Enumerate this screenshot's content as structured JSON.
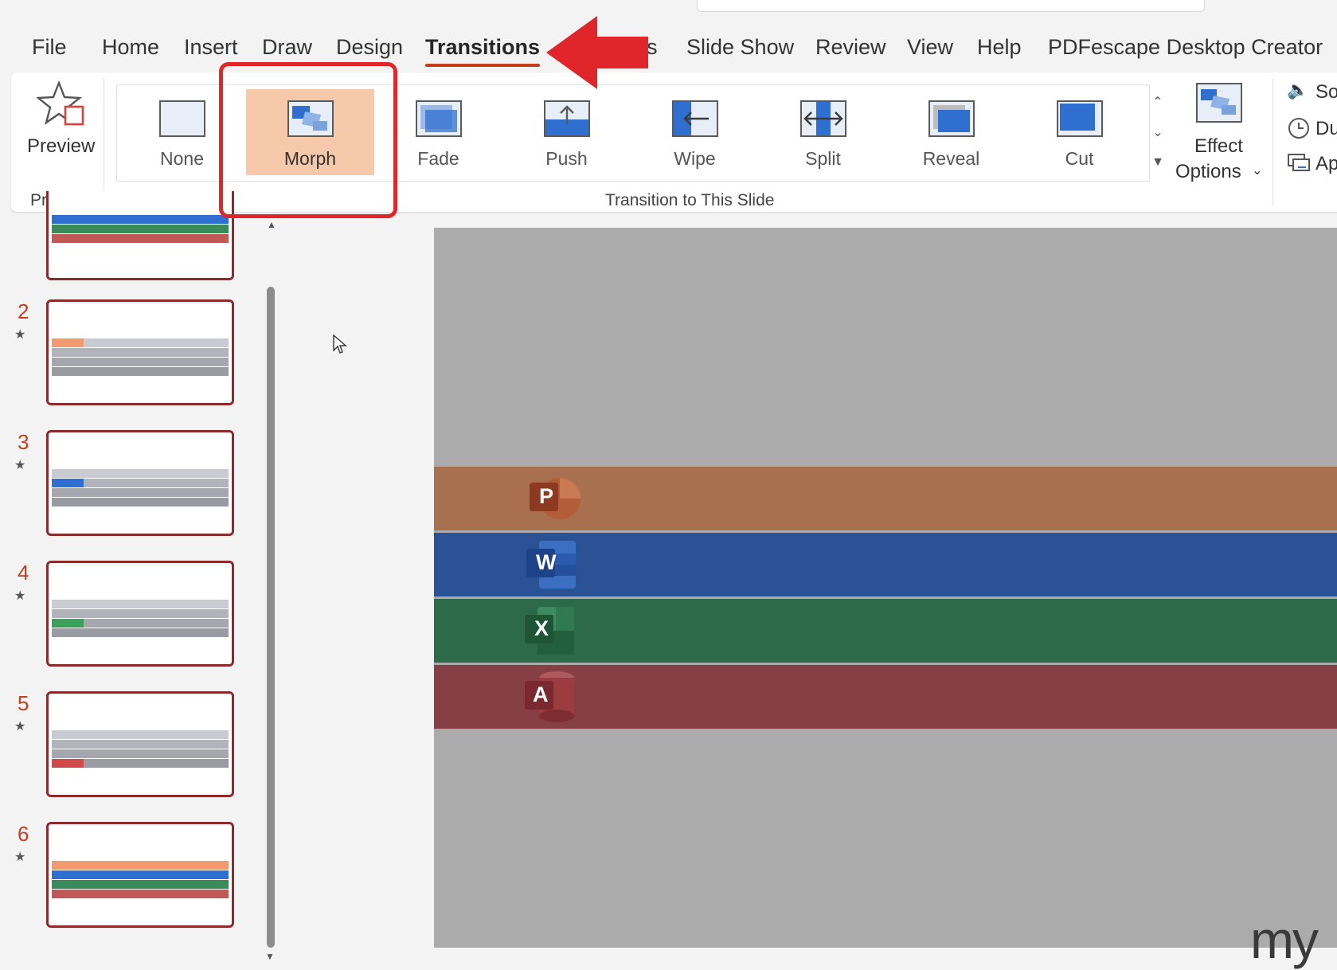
{
  "menu": {
    "tabs": [
      {
        "label": "File"
      },
      {
        "label": "Home"
      },
      {
        "label": "Insert"
      },
      {
        "label": "Draw"
      },
      {
        "label": "Design"
      },
      {
        "label": "Transitions"
      },
      {
        "label": "s"
      },
      {
        "label": "Slide Show"
      },
      {
        "label": "Review"
      },
      {
        "label": "View"
      },
      {
        "label": "Help"
      },
      {
        "label": "PDFescape Desktop Creator"
      }
    ],
    "active_tab": "Transitions"
  },
  "ribbon": {
    "preview": {
      "button_label": "Preview",
      "group_label": "Preview"
    },
    "transitions_group_label": "Transition to This Slide",
    "gallery": [
      {
        "label": "None",
        "icon": "none-transition-icon"
      },
      {
        "label": "Morph",
        "icon": "morph-transition-icon",
        "selected": true
      },
      {
        "label": "Fade",
        "icon": "fade-transition-icon"
      },
      {
        "label": "Push",
        "icon": "push-transition-icon"
      },
      {
        "label": "Wipe",
        "icon": "wipe-transition-icon"
      },
      {
        "label": "Split",
        "icon": "split-transition-icon"
      },
      {
        "label": "Reveal",
        "icon": "reveal-transition-icon"
      },
      {
        "label": "Cut",
        "icon": "cut-transition-icon"
      }
    ],
    "effect_options": {
      "line1": "Effect",
      "line2": "Options"
    },
    "timing": [
      {
        "label": "So",
        "icon": "sound-icon"
      },
      {
        "label": "Du",
        "icon": "duration-clock-icon"
      },
      {
        "label": "Ap",
        "icon": "apply-to-all-icon"
      }
    ]
  },
  "slides": [
    {
      "number": "2",
      "highlight": "#f29a6e"
    },
    {
      "number": "3",
      "highlight": "#2f6fd0"
    },
    {
      "number": "4",
      "highlight": "#3aa05a"
    },
    {
      "number": "5",
      "highlight": "#d04a4a"
    },
    {
      "number": "6",
      "highlight": "all"
    }
  ],
  "slide_canvas": {
    "bands": [
      {
        "letter": "P",
        "color": "#a8704e",
        "icon": "powerpoint-icon"
      },
      {
        "letter": "W",
        "color": "#2b5294",
        "icon": "word-icon"
      },
      {
        "letter": "X",
        "color": "#2d6a4a",
        "icon": "excel-icon"
      },
      {
        "letter": "A",
        "color": "#864043",
        "icon": "access-icon"
      }
    ],
    "background": "#ababab"
  },
  "colors": {
    "accent": "#c43e1c",
    "selection": "#f7c9ab",
    "annotation_red": "#e0262a"
  },
  "watermark": "my"
}
